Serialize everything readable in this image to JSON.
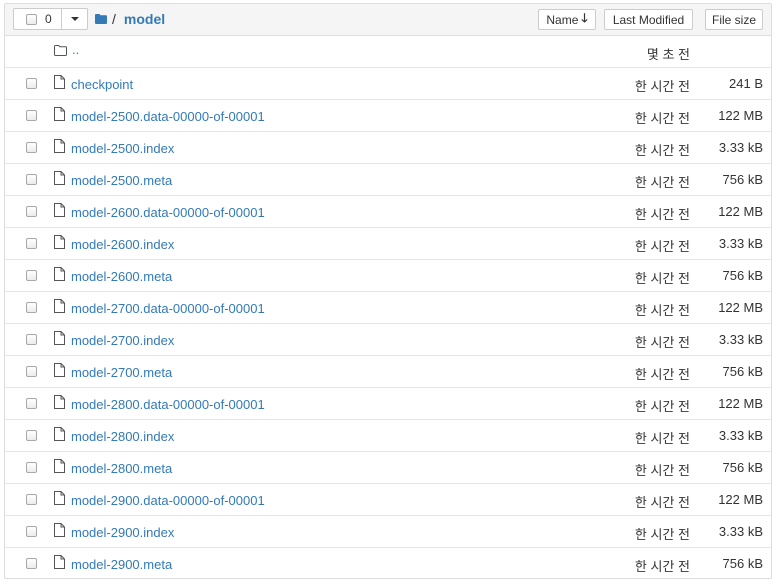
{
  "toolbar": {
    "selected_count": "0",
    "breadcrumb_sep": "/",
    "breadcrumb_current": "model",
    "sort_name_label": "Name",
    "sort_name_arrow": "🡓",
    "sort_modified_label": "Last Modified",
    "sort_size_label": "File size"
  },
  "parent_row": {
    "name": "..",
    "modified": "몇 초 전"
  },
  "files": [
    {
      "name": "checkpoint",
      "modified": "한 시간 전",
      "size": "241 B"
    },
    {
      "name": "model-2500.data-00000-of-00001",
      "modified": "한 시간 전",
      "size": "122 MB"
    },
    {
      "name": "model-2500.index",
      "modified": "한 시간 전",
      "size": "3.33 kB"
    },
    {
      "name": "model-2500.meta",
      "modified": "한 시간 전",
      "size": "756 kB"
    },
    {
      "name": "model-2600.data-00000-of-00001",
      "modified": "한 시간 전",
      "size": "122 MB"
    },
    {
      "name": "model-2600.index",
      "modified": "한 시간 전",
      "size": "3.33 kB"
    },
    {
      "name": "model-2600.meta",
      "modified": "한 시간 전",
      "size": "756 kB"
    },
    {
      "name": "model-2700.data-00000-of-00001",
      "modified": "한 시간 전",
      "size": "122 MB"
    },
    {
      "name": "model-2700.index",
      "modified": "한 시간 전",
      "size": "3.33 kB"
    },
    {
      "name": "model-2700.meta",
      "modified": "한 시간 전",
      "size": "756 kB"
    },
    {
      "name": "model-2800.data-00000-of-00001",
      "modified": "한 시간 전",
      "size": "122 MB"
    },
    {
      "name": "model-2800.index",
      "modified": "한 시간 전",
      "size": "3.33 kB"
    },
    {
      "name": "model-2800.meta",
      "modified": "한 시간 전",
      "size": "756 kB"
    },
    {
      "name": "model-2900.data-00000-of-00001",
      "modified": "한 시간 전",
      "size": "122 MB"
    },
    {
      "name": "model-2900.index",
      "modified": "한 시간 전",
      "size": "3.33 kB"
    },
    {
      "name": "model-2900.meta",
      "modified": "한 시간 전",
      "size": "756 kB"
    }
  ],
  "icons": {
    "folder": "folder-icon",
    "file": "file-icon",
    "up": "folder-outline-icon",
    "checkbox": "checkbox-icon",
    "caret": "caret-down-icon"
  },
  "colors": {
    "link": "#337ab7",
    "header_bg": "#f5f5f5",
    "border": "#dddddd"
  }
}
